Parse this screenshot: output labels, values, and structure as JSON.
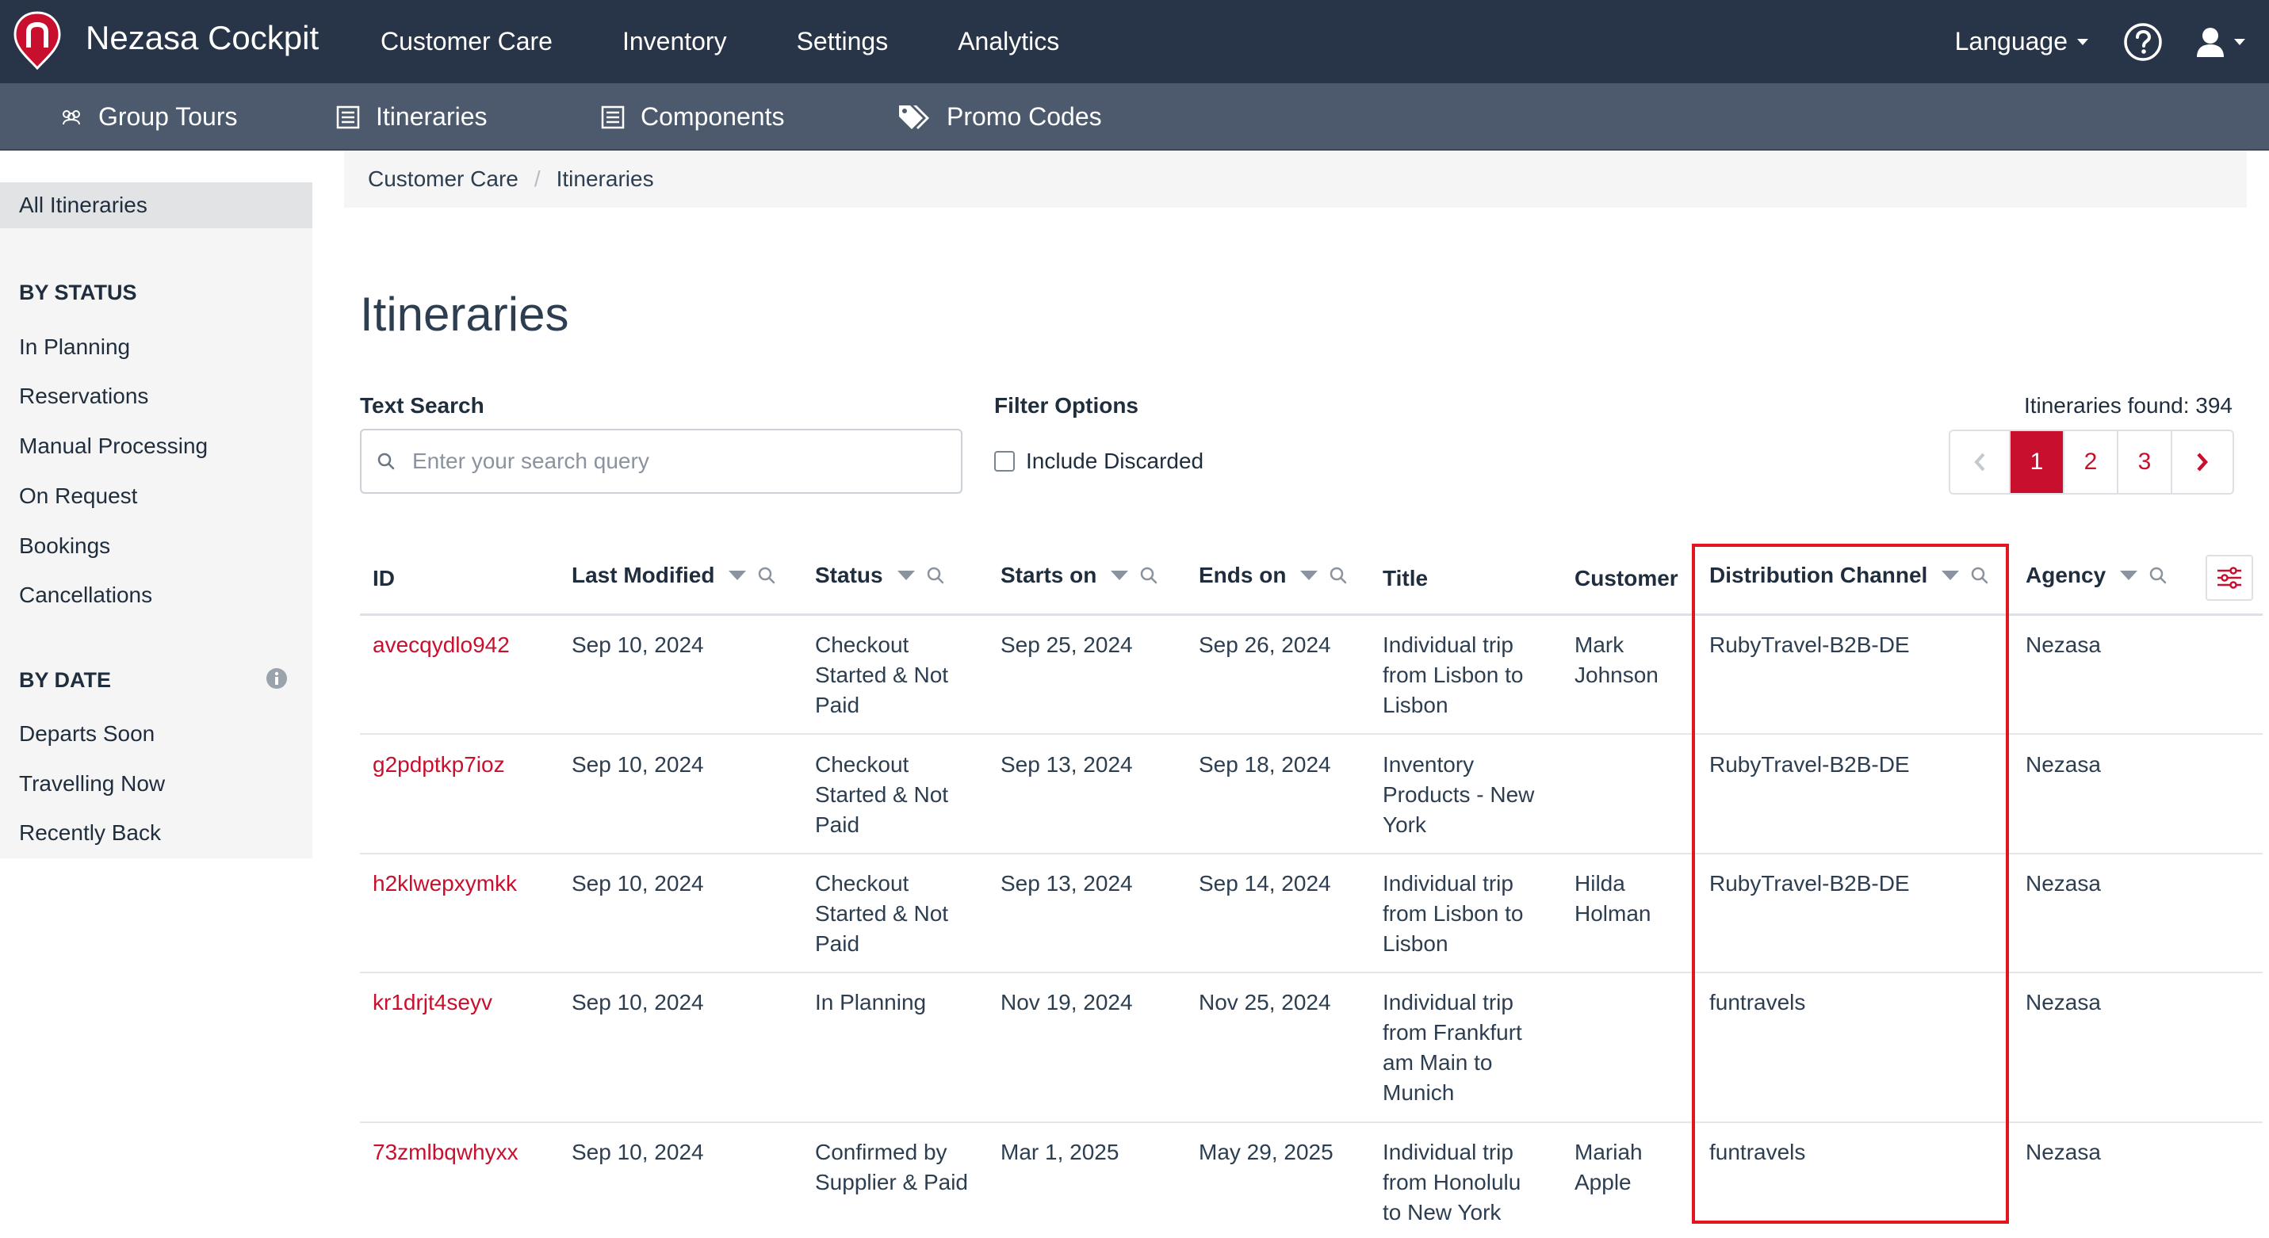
{
  "app": {
    "brand": "Nezasa Cockpit"
  },
  "topnav": [
    "Customer Care",
    "Inventory",
    "Settings",
    "Analytics"
  ],
  "topright": {
    "language": "Language"
  },
  "subnav": [
    {
      "label": "Group Tours",
      "icon": "group-tours-icon"
    },
    {
      "label": "Itineraries",
      "icon": "list-icon"
    },
    {
      "label": "Components",
      "icon": "list-icon"
    },
    {
      "label": "Promo Codes",
      "icon": "tags-icon"
    }
  ],
  "sidebar": {
    "active": "All Itineraries",
    "by_status_heading": "BY STATUS",
    "by_status": [
      "In Planning",
      "Reservations",
      "Manual Processing",
      "On Request",
      "Bookings",
      "Cancellations"
    ],
    "by_date_heading": "BY DATE",
    "by_date": [
      "Departs Soon",
      "Travelling Now",
      "Recently Back"
    ]
  },
  "breadcrumb": [
    "Customer Care",
    "Itineraries"
  ],
  "page": {
    "title": "Itineraries",
    "text_search_label": "Text Search",
    "search_placeholder": "Enter your search query",
    "filter_label": "Filter Options",
    "include_discarded": "Include Discarded",
    "found": "Itineraries found: 394"
  },
  "pagination": {
    "pages": [
      "1",
      "2",
      "3"
    ],
    "current": "1"
  },
  "table": {
    "columns": {
      "id": "ID",
      "last_modified": "Last Modified",
      "status": "Status",
      "starts_on": "Starts on",
      "ends_on": "Ends on",
      "title": "Title",
      "customer": "Customer",
      "distribution": "Distribution Channel",
      "agency": "Agency"
    },
    "rows": [
      {
        "id": "avecqydlo942",
        "last_modified": "Sep 10, 2024",
        "status": [
          "Checkout",
          "Started & Not",
          "Paid"
        ],
        "starts_on": "Sep 25, 2024",
        "ends_on": "Sep 26, 2024",
        "title": [
          "Individual trip",
          "from Lisbon to",
          "Lisbon"
        ],
        "customer": [
          "Mark",
          "Johnson"
        ],
        "distribution": "RubyTravel-B2B-DE",
        "agency": "Nezasa"
      },
      {
        "id": "g2pdptkp7ioz",
        "last_modified": "Sep 10, 2024",
        "status": [
          "Checkout",
          "Started & Not",
          "Paid"
        ],
        "starts_on": "Sep 13, 2024",
        "ends_on": "Sep 18, 2024",
        "title": [
          "Inventory",
          "Products - New",
          "York"
        ],
        "customer": [
          "",
          ""
        ],
        "distribution": "RubyTravel-B2B-DE",
        "agency": "Nezasa"
      },
      {
        "id": "h2klwepxymkk",
        "last_modified": "Sep 10, 2024",
        "status": [
          "Checkout",
          "Started & Not",
          "Paid"
        ],
        "starts_on": "Sep 13, 2024",
        "ends_on": "Sep 14, 2024",
        "title": [
          "Individual trip",
          "from Lisbon to",
          "Lisbon"
        ],
        "customer": [
          "Hilda",
          "Holman"
        ],
        "distribution": "RubyTravel-B2B-DE",
        "agency": "Nezasa"
      },
      {
        "id": "kr1drjt4seyv",
        "last_modified": "Sep 10, 2024",
        "status": [
          "In Planning"
        ],
        "starts_on": "Nov 19, 2024",
        "ends_on": "Nov 25, 2024",
        "title": [
          "Individual trip",
          "from Frankfurt",
          "am Main to",
          "Munich"
        ],
        "customer": [
          "",
          ""
        ],
        "distribution": "funtravels",
        "agency": "Nezasa"
      },
      {
        "id": "73zmlbqwhyxx",
        "last_modified": "Sep 10, 2024",
        "status": [
          "Confirmed by",
          "Supplier & Paid"
        ],
        "starts_on": "Mar 1, 2025",
        "ends_on": "May 29, 2025",
        "title": [
          "Individual trip",
          "from Honolulu",
          "to New York"
        ],
        "customer": [
          "Mariah",
          "Apple"
        ],
        "distribution": "funtravels",
        "agency": "Nezasa"
      }
    ]
  },
  "colors": {
    "navbar": "#283447",
    "subnav": "#4d5a6d",
    "accent": "#c8102e",
    "highlight": "#e3151e"
  }
}
